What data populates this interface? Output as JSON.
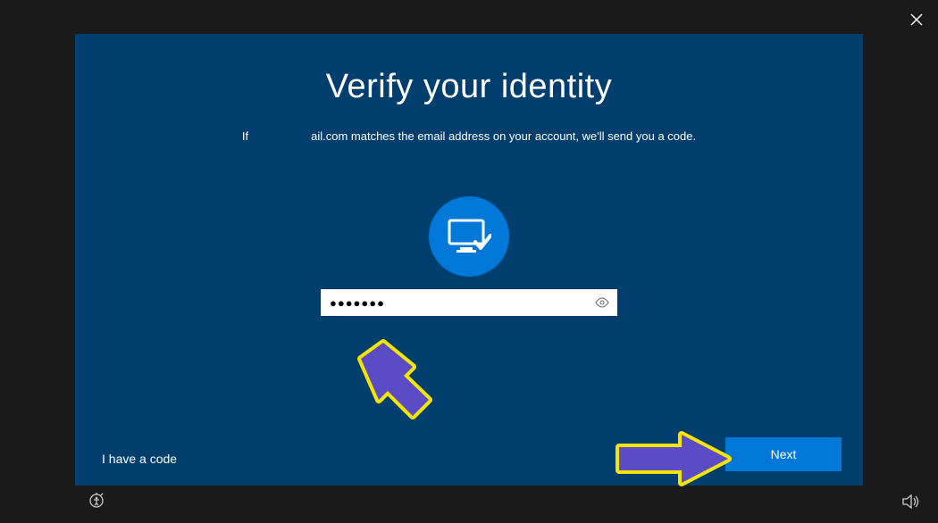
{
  "title": "Verify your identity",
  "subtitle_prefix": "If",
  "subtitle_suffix": "ail.com matches the email address on your account, we'll send you a code.",
  "input": {
    "value": "●●●●●●●",
    "placeholder": ""
  },
  "links": {
    "have_code": "I have a code"
  },
  "buttons": {
    "next": "Next"
  },
  "colors": {
    "panel_bg": "#003e6e",
    "accent": "#0078d7"
  }
}
